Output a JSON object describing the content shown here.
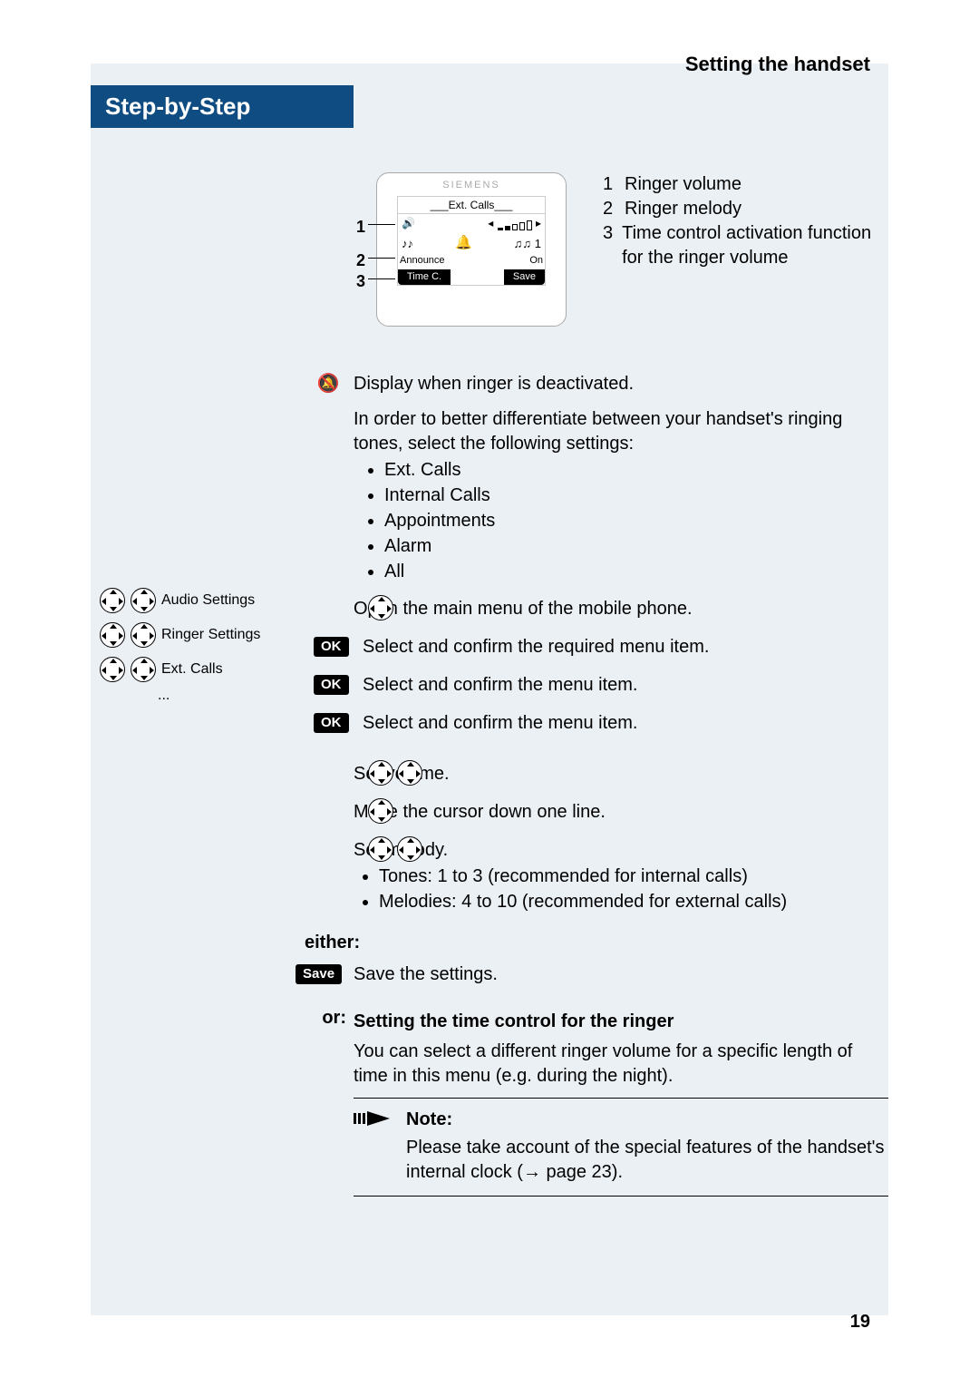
{
  "header": {
    "title": "Setting the handset"
  },
  "sidebar": {
    "step_label": "Step-by-Step"
  },
  "phone": {
    "brand": "SIEMENS",
    "screen_title": "Ext. Calls",
    "announce_label": "Announce",
    "on_label": "On",
    "melody_num": "1",
    "btn_left": "Time C.",
    "btn_right": "Save",
    "callout_1": "1",
    "callout_2": "2",
    "callout_3": "3"
  },
  "legend": {
    "items": [
      {
        "num": "1",
        "text": "Ringer volume"
      },
      {
        "num": "2",
        "text": "Ringer melody"
      },
      {
        "num": "3",
        "text": "Time control activation function for the ringer volume"
      }
    ]
  },
  "para_deact": "Display when ringer is deactivated.",
  "para_diff": "In order to better differentiate between your handset's ringing tones, select the following settings:",
  "tone_list": [
    "Ext. Calls",
    "Internal Calls",
    "Appointments",
    "Alarm",
    "All"
  ],
  "steps": {
    "open_menu": "Open the main menu of the mobile phone.",
    "menu1_label": "Audio Settings",
    "menu1_text": "Select and confirm the required menu item.",
    "menu2_label": "Ringer Settings",
    "menu2_text": "Select and confirm the menu item.",
    "menu3_label": "Ext. Calls",
    "menu3_ellipsis": "...",
    "menu3_text": "Select and confirm the menu item.",
    "set_volume": "Set volume.",
    "move_down": "Move the cursor down one line.",
    "set_melody": "Set melody.",
    "melody_bullets": [
      "Tones: 1 to 3 (recommended for internal calls)",
      "Melodies: 4 to 10 (recommended for external calls)"
    ],
    "ok_label": "OK"
  },
  "either_label": "either:",
  "save_label": "Save",
  "save_text": "Save the settings.",
  "or_label": "or:",
  "time_ctrl_heading": "Setting the time control for the ringer",
  "time_ctrl_text": "You can select a different ringer volume for a specific length of time in this menu (e.g. during the night).",
  "note": {
    "title": "Note:",
    "body_a": "Please take account of the special features of the handset's internal clock (",
    "body_arrow": "→",
    "body_b": " page 23)."
  },
  "page_number": "19"
}
